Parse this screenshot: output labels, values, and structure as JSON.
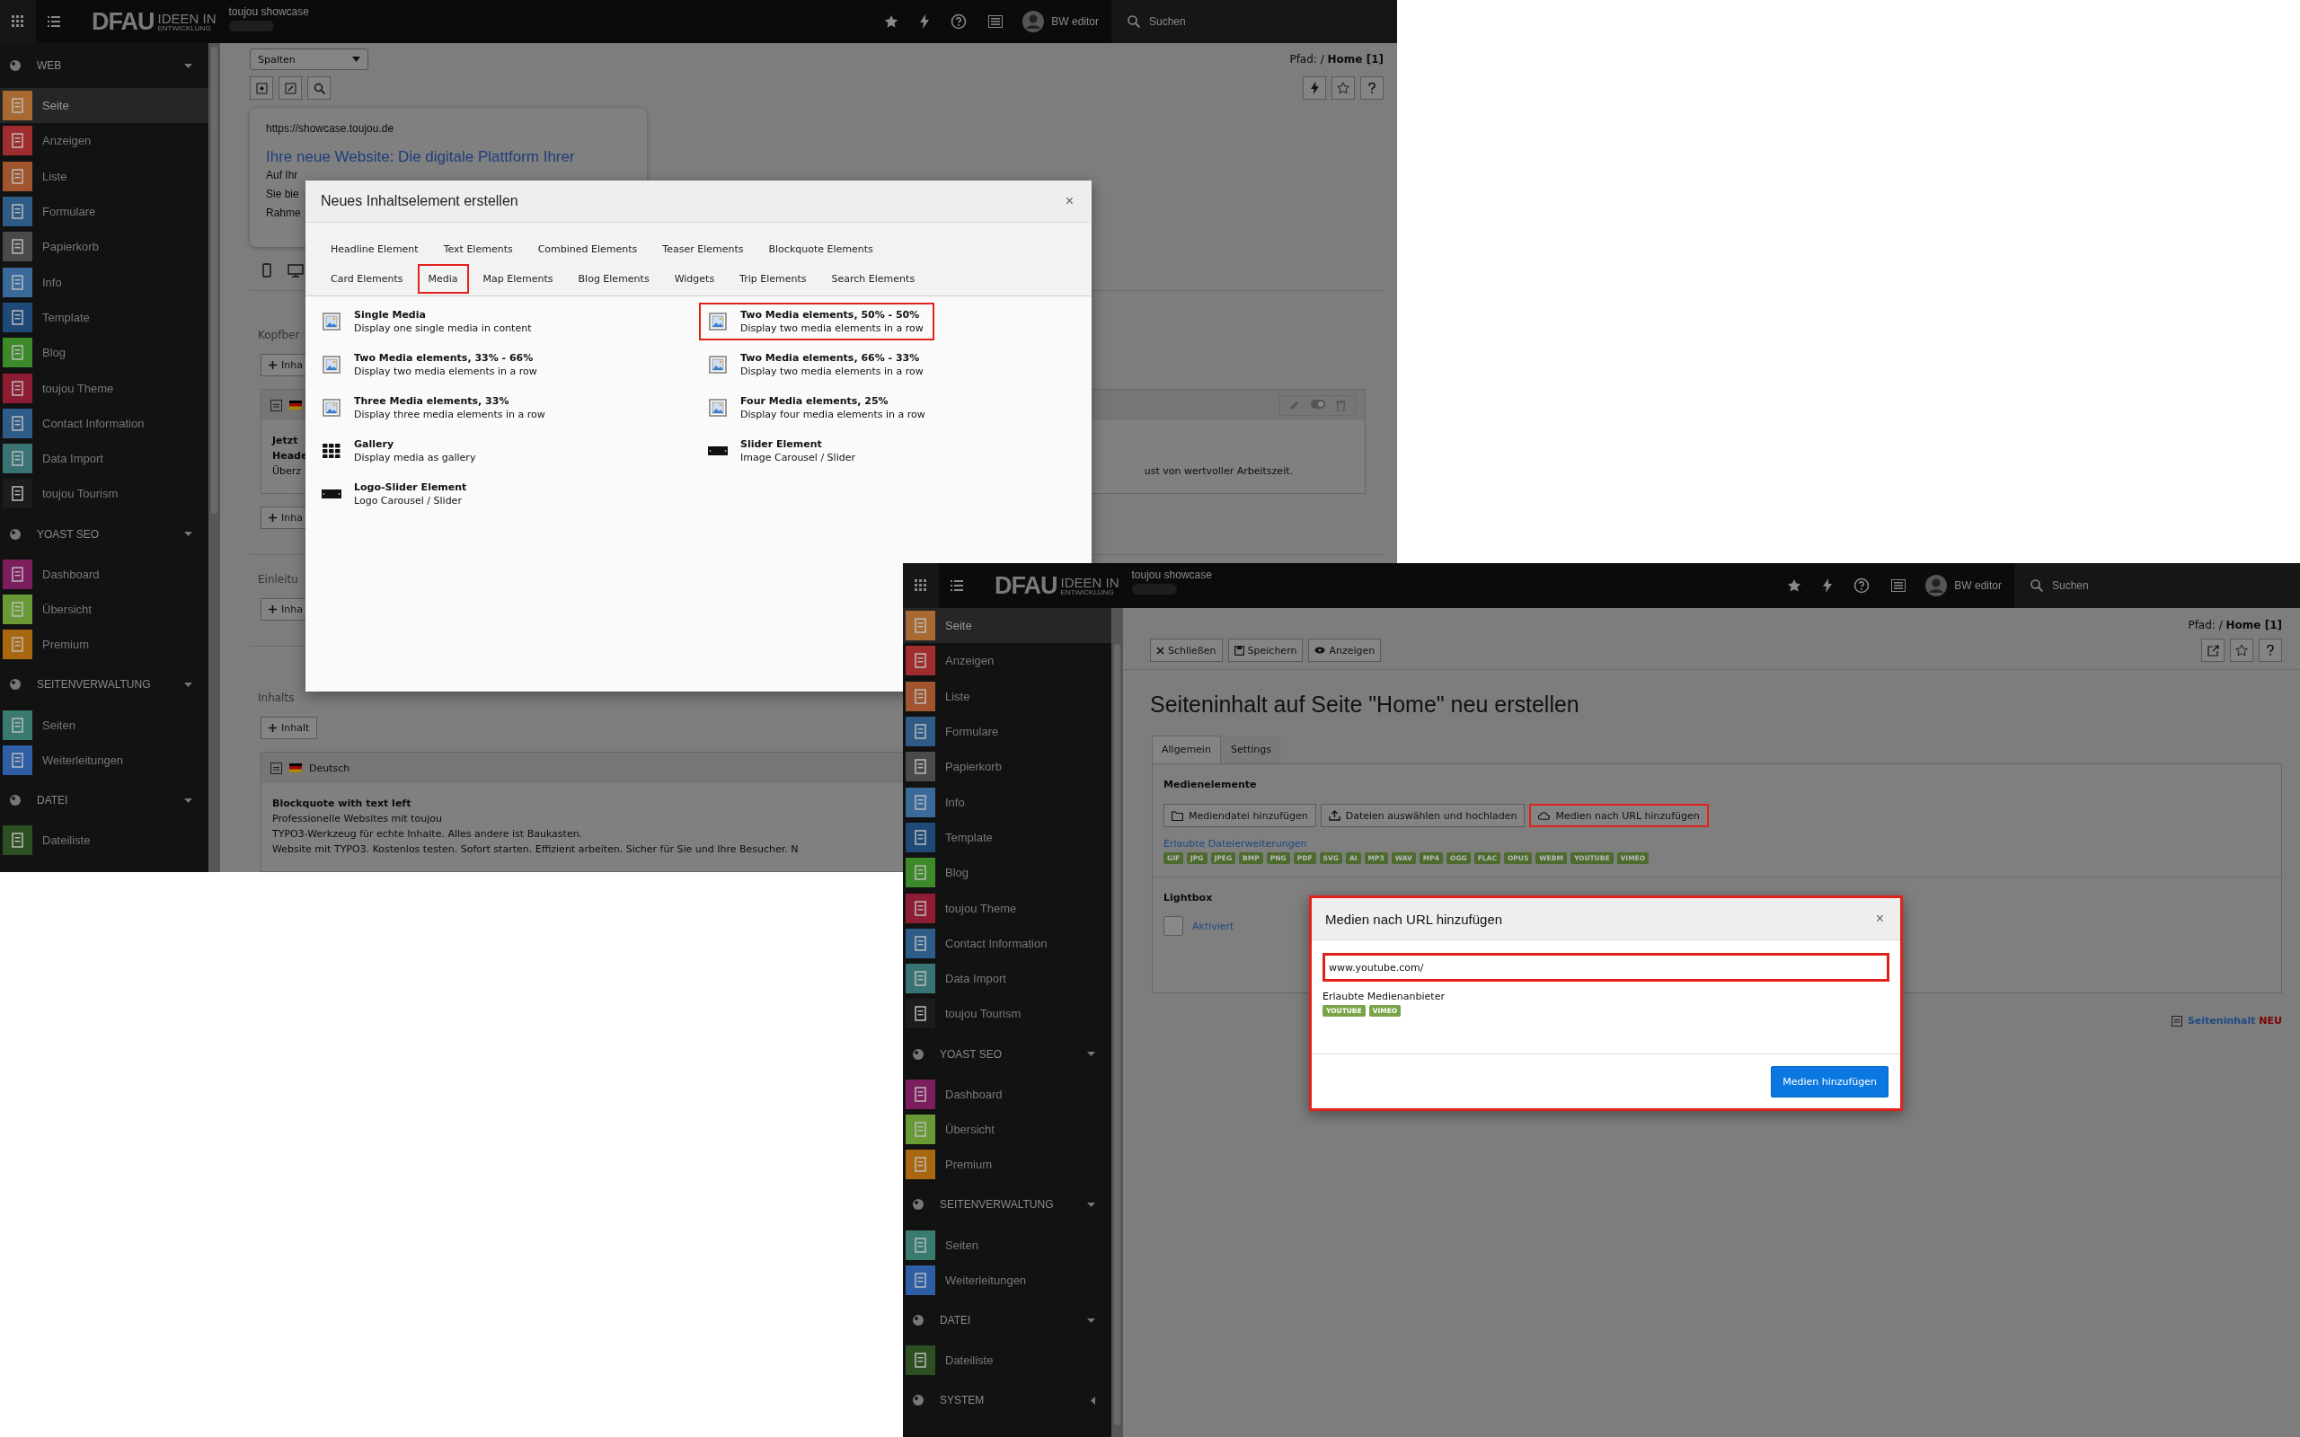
{
  "left_screen": {
    "header": {
      "logo_main": "DFAU",
      "logo_top": "IDEEN IN",
      "logo_bottom": "ENTWICKLUNG",
      "site": "toujou showcase",
      "user": "BW editor",
      "search_placeholder": "Suchen"
    },
    "sidebar": {
      "sections": [
        {
          "title": "WEB",
          "expanded": true,
          "items": [
            {
              "label": "Seite",
              "selected": true,
              "color": "#a86a32"
            },
            {
              "label": "Anzeigen",
              "selected": false,
              "color": "#a02d2d"
            },
            {
              "label": "Liste",
              "selected": false,
              "color": "#a0552f"
            },
            {
              "label": "Formulare",
              "selected": false,
              "color": "#2f5c86"
            },
            {
              "label": "Papierkorb",
              "selected": false,
              "color": "#4a4a4a"
            },
            {
              "label": "Info",
              "selected": false,
              "color": "#3a6a9a"
            },
            {
              "label": "Template",
              "selected": false,
              "color": "#1f4a78"
            },
            {
              "label": "Blog",
              "selected": false,
              "color": "#3d8a2a"
            },
            {
              "label": "toujou Theme",
              "selected": false,
              "color": "#8e1d34"
            },
            {
              "label": "Contact Information",
              "selected": false,
              "color": "#2e5c88"
            },
            {
              "label": "Data Import",
              "selected": false,
              "color": "#3a7373"
            },
            {
              "label": "toujou Tourism",
              "selected": false,
              "color": "#1c1c1c"
            }
          ]
        },
        {
          "title": "YOAST SEO",
          "expanded": true,
          "items": [
            {
              "label": "Dashboard",
              "selected": false,
              "color": "#7c1d5e"
            },
            {
              "label": "Übersicht",
              "selected": false,
              "color": "#6a9a35"
            },
            {
              "label": "Premium",
              "selected": false,
              "color": "#a8680f"
            }
          ]
        },
        {
          "title": "SEITENVERWALTUNG",
          "expanded": true,
          "items": [
            {
              "label": "Seiten",
              "selected": false,
              "color": "#3a7b70"
            },
            {
              "label": "Weiterleitungen",
              "selected": false,
              "color": "#2e5ea6"
            }
          ]
        },
        {
          "title": "DATEI",
          "expanded": true,
          "items": [
            {
              "label": "Dateiliste",
              "selected": false,
              "color": "#2d5023"
            }
          ]
        }
      ]
    },
    "view_select": "Spalten",
    "path": {
      "label": "Pfad: /",
      "page": "Home [1]"
    },
    "preview_card": {
      "url": "https://showcase.toujou.de",
      "link_lines": [
        "Ihre neue Website: Die digitale Plattform Ihrer"
      ],
      "text_lines": [
        "Auf Ihr",
        "Sie bie",
        "Rahme"
      ]
    },
    "page_content": {
      "header_area": {
        "label": "Kopfber",
        "add_buttons": [
          "Inha",
          "Inha"
        ],
        "element": {
          "bold_lines": [
            "Jetzt",
            "Heade"
          ],
          "text": "Überz",
          "text_end": "ust von wertvoller Arbeitszeit."
        }
      },
      "intro_area": {
        "label": "Einleitu",
        "add_button": "Inha"
      },
      "main_area": {
        "label": "Inhalts",
        "add_button": "Inhalt",
        "element": {
          "language": "Deutsch",
          "title": "Blockquote with text left",
          "lines": [
            "Professionelle Websites mit toujou",
            "TYPO3-Werkzeug für echte Inhalte. Alles andere ist Baukasten.",
            "Website mit TYPO3. Kostenlos testen. Sofort starten. Effizient arbeiten. Sicher für Sie und Ihre Besucher. N"
          ]
        }
      }
    }
  },
  "content_element_wizard": {
    "title": "Neues Inhaltselement erstellen",
    "close": "×",
    "tabs": [
      {
        "label": "Headline Element",
        "highlighted": false
      },
      {
        "label": "Text Elements",
        "highlighted": false
      },
      {
        "label": "Combined Elements",
        "highlighted": false
      },
      {
        "label": "Teaser Elements",
        "highlighted": false
      },
      {
        "label": "Blockquote Elements",
        "highlighted": false
      },
      {
        "label": "Card Elements",
        "highlighted": false
      },
      {
        "label": "Media",
        "highlighted": true
      },
      {
        "label": "Map Elements",
        "highlighted": false
      },
      {
        "label": "Blog Elements",
        "highlighted": false
      },
      {
        "label": "Widgets",
        "highlighted": false
      },
      {
        "label": "Trip Elements",
        "highlighted": false
      },
      {
        "label": "Search Elements",
        "highlighted": false
      }
    ],
    "items": [
      {
        "kind": "media",
        "title": "Single Media",
        "description": "Display one single media in content",
        "highlighted": false
      },
      {
        "kind": "media",
        "title": "Two Media elements, 50% - 50%",
        "description": "Display two media elements in a row",
        "highlighted": true
      },
      {
        "kind": "media",
        "title": "Two Media elements, 33% - 66%",
        "description": "Display two media elements in a row",
        "highlighted": false
      },
      {
        "kind": "media",
        "title": "Two Media elements, 66% - 33%",
        "description": "Display two media elements in a row",
        "highlighted": false
      },
      {
        "kind": "media",
        "title": "Three Media elements, 33%",
        "description": "Display three media elements in a row",
        "highlighted": false
      },
      {
        "kind": "media",
        "title": "Four Media elements, 25%",
        "description": "Display four media elements in a row",
        "highlighted": false
      },
      {
        "kind": "gallery",
        "title": "Gallery",
        "description": "Display media as gallery",
        "highlighted": false
      },
      {
        "kind": "slider",
        "title": "Slider Element",
        "description": "Image Carousel / Slider",
        "highlighted": false
      },
      {
        "kind": "slider",
        "title": "Logo-Slider Element",
        "description": "Logo Carousel / Slider",
        "highlighted": false
      }
    ]
  },
  "right_screen": {
    "header": {
      "logo_main": "DFAU",
      "logo_top": "IDEEN IN",
      "logo_bottom": "ENTWICKLUNG",
      "site": "toujou showcase",
      "user": "BW editor",
      "search_placeholder": "Suchen"
    },
    "sidebar": {
      "sections": [
        {
          "items": [
            {
              "label": "Seite",
              "selected": true,
              "color": "#a86a32"
            },
            {
              "label": "Anzeigen",
              "selected": false,
              "color": "#a02d2d"
            },
            {
              "label": "Liste",
              "selected": false,
              "color": "#a0552f"
            },
            {
              "label": "Formulare",
              "selected": false,
              "color": "#2f5c86"
            },
            {
              "label": "Papierkorb",
              "selected": false,
              "color": "#4a4a4a"
            },
            {
              "label": "Info",
              "selected": false,
              "color": "#3a6a9a"
            },
            {
              "label": "Template",
              "selected": false,
              "color": "#1f4a78"
            },
            {
              "label": "Blog",
              "selected": false,
              "color": "#3d8a2a"
            },
            {
              "label": "toujou Theme",
              "selected": false,
              "color": "#8e1d34"
            },
            {
              "label": "Contact Information",
              "selected": false,
              "color": "#2e5c88"
            },
            {
              "label": "Data Import",
              "selected": false,
              "color": "#3a7373"
            },
            {
              "label": "toujou Tourism",
              "selected": false,
              "color": "#1c1c1c"
            }
          ]
        },
        {
          "title": "YOAST SEO",
          "expanded": true,
          "items": [
            {
              "label": "Dashboard",
              "selected": false,
              "color": "#7c1d5e"
            },
            {
              "label": "Übersicht",
              "selected": false,
              "color": "#6a9a35"
            },
            {
              "label": "Premium",
              "selected": false,
              "color": "#a8680f"
            }
          ]
        },
        {
          "title": "SEITENVERWALTUNG",
          "expanded": true,
          "items": [
            {
              "label": "Seiten",
              "selected": false,
              "color": "#3a7b70"
            },
            {
              "label": "Weiterleitungen",
              "selected": false,
              "color": "#2e5ea6"
            }
          ]
        },
        {
          "title": "DATEI",
          "expanded": true,
          "items": [
            {
              "label": "Dateiliste",
              "selected": false,
              "color": "#2d5023"
            }
          ]
        },
        {
          "title": "SYSTEM",
          "expanded": false
        }
      ]
    },
    "path": {
      "label": "Pfad: /",
      "page": "Home [1]"
    },
    "toolbar": [
      "Schließen",
      "Speichern",
      "Anzeigen"
    ],
    "title": "Seiteninhalt auf Seite \"Home\" neu erstellen",
    "tabs": [
      {
        "label": "Allgemein",
        "selected": true
      },
      {
        "label": "Settings",
        "selected": false
      }
    ],
    "form": {
      "media_label": "Medienelemente",
      "buttons": [
        {
          "label": "Mediendatei hinzufügen",
          "highlighted": false
        },
        {
          "label": "Dateien auswählen und hochladen",
          "highlighted": false
        },
        {
          "label": "Medien nach URL hinzufügen",
          "highlighted": true
        }
      ],
      "extensions_link": "Erlaubte Dateierweiterungen",
      "extensions": [
        "GIF",
        "JPG",
        "JPEG",
        "BMP",
        "PNG",
        "PDF",
        "SVG",
        "AI",
        "MP3",
        "WAV",
        "MP4",
        "OGG",
        "FLAC",
        "OPUS",
        "WEBM",
        "YOUTUBE",
        "VIMEO"
      ],
      "lightbox_label": "Lightbox",
      "lightbox_checkbox": {
        "label": "Aktiviert",
        "checked": false
      }
    },
    "record_label": "Seiteninhalt",
    "record_state": "NEU"
  },
  "media_url_dialog": {
    "title": "Medien nach URL hinzufügen",
    "close": "×",
    "highlighted": true,
    "input": {
      "value": "www.youtube.com/",
      "highlighted": true
    },
    "providers_label": "Erlaubte Medienanbieter",
    "providers": [
      "YOUTUBE",
      "VIMEO"
    ],
    "submit": "Medien hinzufügen"
  }
}
